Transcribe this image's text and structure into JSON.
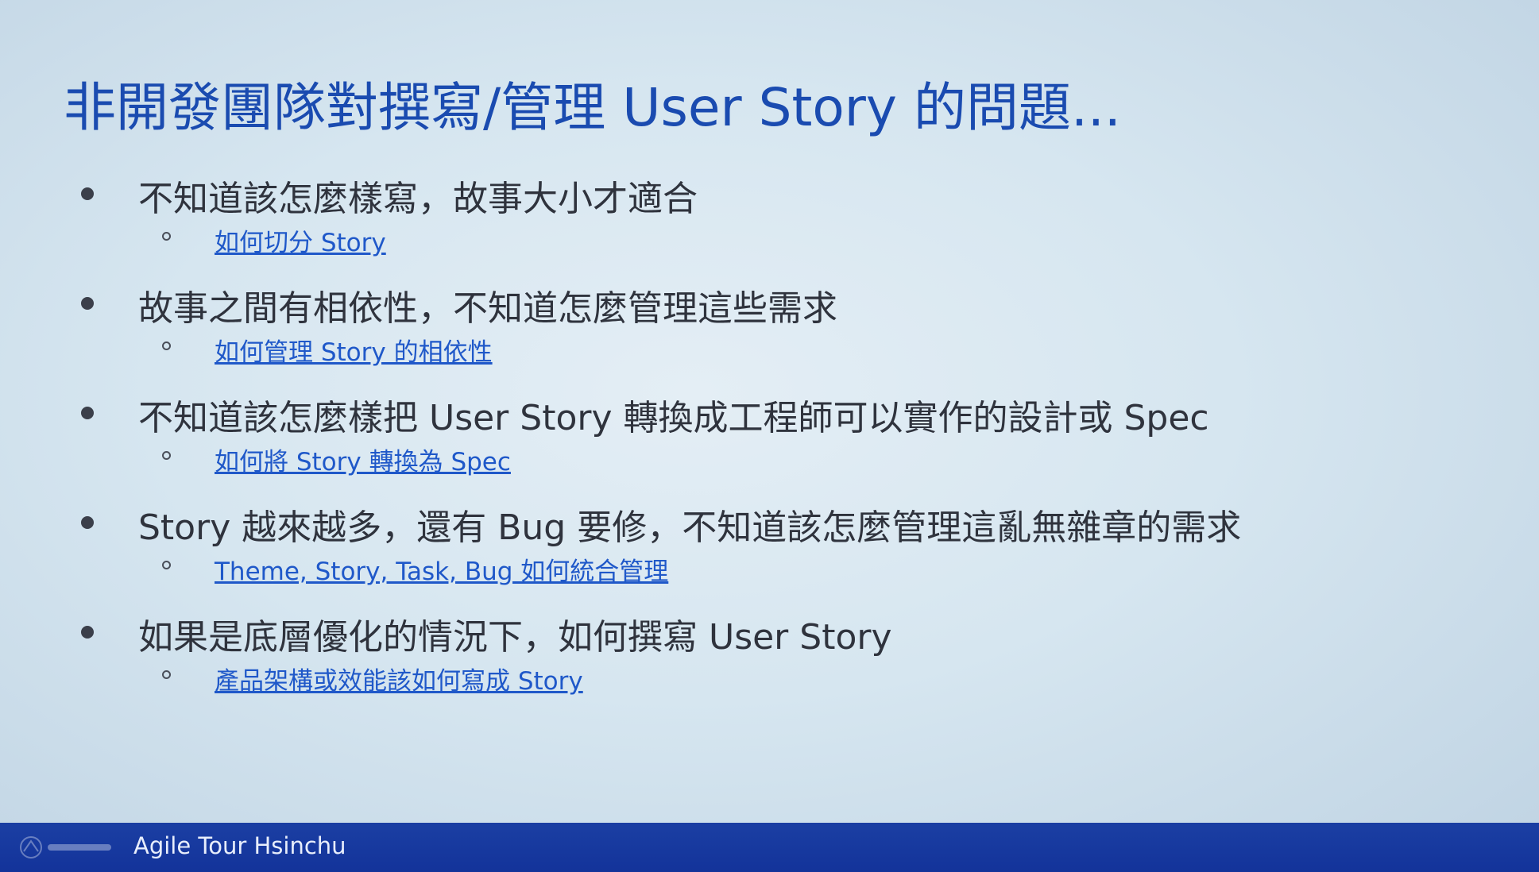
{
  "slide": {
    "title": "非開發團隊對撰寫/管理 User Story 的問題...",
    "bullets": [
      {
        "text": "不知道該怎麼樣寫，故事大小才適合",
        "link": "如何切分 Story"
      },
      {
        "text": "故事之間有相依性，不知道怎麼管理這些需求",
        "link": "如何管理 Story 的相依性"
      },
      {
        "text": "不知道該怎麼樣把 User Story 轉換成工程師可以實作的設計或 Spec",
        "link": "如何將 Story 轉換為 Spec"
      },
      {
        "text": "Story 越來越多，還有 Bug 要修，不知道該怎麼管理這亂無雜章的需求",
        "link": "Theme, Story, Task, Bug 如何統合管理"
      },
      {
        "text": "如果是底層優化的情況下，如何撰寫 User Story",
        "link": "產品架構或效能該如何寫成 Story"
      }
    ]
  },
  "footer": {
    "text": "Agile Tour Hsinchu",
    "logo_icon": "agile-tour-logo-icon"
  },
  "colors": {
    "title": "#1a4bb0",
    "body_text": "#2f333d",
    "link": "#1f58c9",
    "footer_bar": "#13339a"
  }
}
